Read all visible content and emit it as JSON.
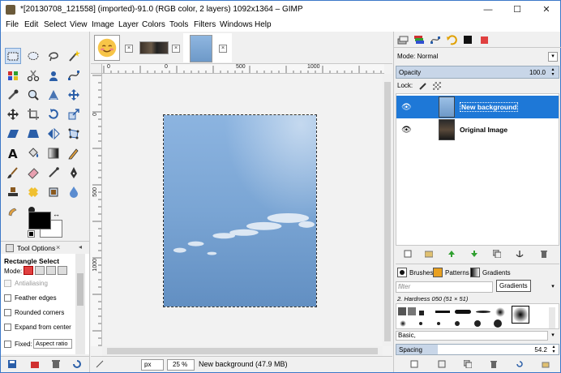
{
  "window": {
    "title": "*[20130708_121558] (imported)-91.0 (RGB color, 2 layers) 1092x1364 – GIMP",
    "minimize": "—",
    "maximize": "☐",
    "close": "✕"
  },
  "menu": [
    "File",
    "Edit",
    "Select",
    "View",
    "Image",
    "Layer",
    "Colors",
    "Tools",
    "Filters",
    "Windows",
    "Help"
  ],
  "toolbox": {
    "tabs": {
      "label": "Tool Options",
      "close": "×",
      "menu": "◂"
    },
    "options": {
      "title": "Rectangle Select",
      "mode_label": "Mode:",
      "checkboxes": [
        {
          "label": "Antialiasing",
          "checked": true,
          "enabled": false
        },
        {
          "label": "Feather edges",
          "checked": false,
          "enabled": true
        },
        {
          "label": "Rounded corners",
          "checked": false,
          "enabled": true
        },
        {
          "label": "Expand from center",
          "checked": false,
          "enabled": true
        },
        {
          "label": "Fixed:",
          "checked": false,
          "enabled": true
        }
      ],
      "fixed_value": "Aspect ratio"
    },
    "swap_glyph": "↔"
  },
  "image_tabs": [
    {
      "name": "emoji-image",
      "close": "×"
    },
    {
      "name": "dark-image",
      "close": "×"
    },
    {
      "name": "sky-image",
      "close": "×",
      "active": true
    }
  ],
  "rulers": {
    "h_labels": [
      "0",
      "0",
      "500",
      "1000"
    ],
    "v_labels": [
      "0",
      "500",
      "1000"
    ]
  },
  "status": {
    "unit": "px",
    "zoom": "25 %",
    "text": "New background (47.9 MB)"
  },
  "layers": {
    "mode_label": "Mode: Normal",
    "opacity_label": "Opacity",
    "opacity_value": "100.0",
    "lock_label": "Lock:",
    "items": [
      {
        "name": "New background",
        "selected": true,
        "visible": true
      },
      {
        "name": "Original Image",
        "selected": false,
        "visible": true
      }
    ]
  },
  "brushes": {
    "tabs": [
      "Brushes",
      "Patterns",
      "Gradients"
    ],
    "tooltip": "Gradients",
    "filter_placeholder": "filter",
    "caption": "2. Hardness 050 (51 × 51)",
    "preset": "Basic,",
    "spacing_label": "Spacing",
    "spacing_value": "54.2",
    "spacing_fraction": 0.254
  }
}
